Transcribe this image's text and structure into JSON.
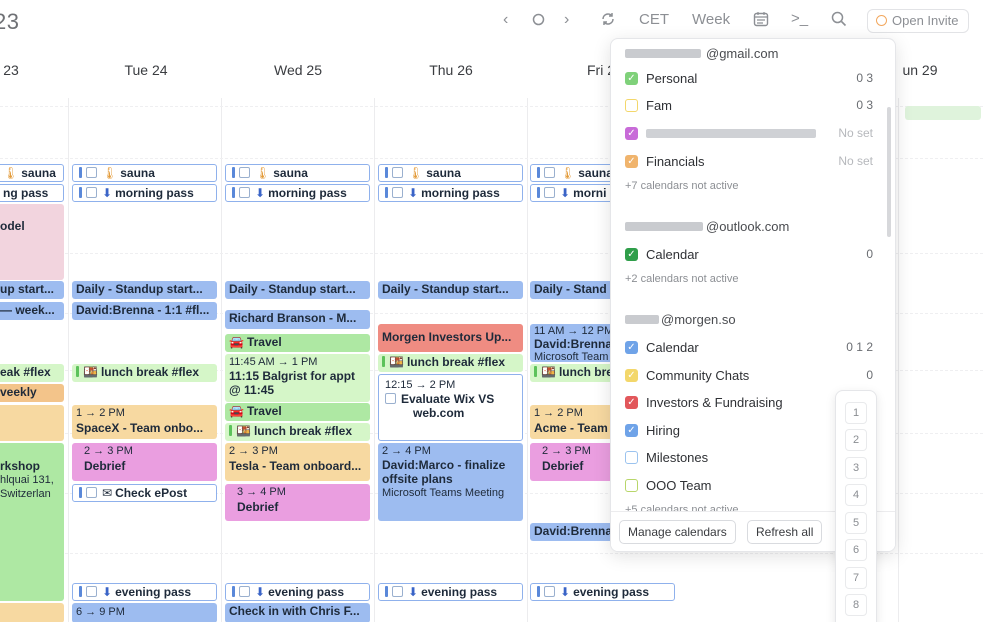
{
  "toolbar": {
    "year_fragment": "23",
    "tz_label": "CET",
    "view_label": "Week",
    "open_invite_label": "Open Invite"
  },
  "days": [
    "23",
    "Tue 24",
    "Wed 25",
    "Thu 26",
    "Fri 2",
    "un 29"
  ],
  "events": {
    "c0": [
      {
        "text": "sauna",
        "icon": "sauna"
      },
      {
        "text": "ng pass"
      },
      {
        "text": "odel"
      },
      {
        "text": "up start..."
      },
      {
        "text": "— week..."
      },
      {
        "text": "eak #flex"
      },
      {
        "text": "veekly"
      },
      {
        "text": "rkshop"
      },
      {
        "text": "hlquai 131,"
      },
      {
        "text": "Switzerlan"
      }
    ],
    "c1": [
      {
        "text": "sauna"
      },
      {
        "text": "morning pass"
      },
      {
        "text": "Daily - Standup start..."
      },
      {
        "text": "David:Brenna - 1:1 #fl..."
      },
      {
        "text": "lunch break #flex"
      },
      {
        "time": "1 → 2 PM",
        "text": "SpaceX - Team onbo..."
      },
      {
        "time": "2 → 3 PM",
        "text": "Debrief"
      },
      {
        "text": "Check ePost"
      },
      {
        "text": "evening pass"
      },
      {
        "time": "6 → 9 PM"
      }
    ],
    "c2": [
      {
        "text": "sauna"
      },
      {
        "text": "morning pass"
      },
      {
        "text": "Daily - Standup start..."
      },
      {
        "text": "Richard Branson - M..."
      },
      {
        "text": "Travel"
      },
      {
        "time": "11:45 AM → 1 PM",
        "text": "11:15 Balgrist for appt",
        "text2": "@ 11:45"
      },
      {
        "text": "Travel"
      },
      {
        "text": "lunch break #flex"
      },
      {
        "time": "2 → 3 PM",
        "text": "Tesla - Team onboard..."
      },
      {
        "time": "3 → 4 PM",
        "text": "Debrief"
      },
      {
        "text": "evening pass"
      },
      {
        "text": "Check in with Chris F..."
      }
    ],
    "c3": [
      {
        "text": "sauna"
      },
      {
        "text": "morning pass"
      },
      {
        "text": "Daily - Standup start..."
      },
      {
        "text": "Morgen Investors Up..."
      },
      {
        "text": "lunch break #flex"
      },
      {
        "time": "12:15 → 2 PM",
        "text": "Evaluate Wix VS",
        "text2": "web.com"
      },
      {
        "time": "2 → 4 PM",
        "text": "David:Marco - finalize",
        "text2": "offsite plans",
        "text3": "Microsoft Teams Meeting"
      },
      {
        "text": "evening pass"
      }
    ],
    "c4": [
      {
        "text": "sauna"
      },
      {
        "text": "morni"
      },
      {
        "text": "Daily - Stand"
      },
      {
        "time": "11 AM → 12 PM",
        "text": "David:Brenna",
        "text2": "Microsoft Team"
      },
      {
        "text": "lunch bre"
      },
      {
        "time": "1 → 2 PM",
        "text": "Acme - Team"
      },
      {
        "time": "2 → 3 PM",
        "text": "Debrief"
      },
      {
        "text": "David:Brenna"
      },
      {
        "text": "evening pass"
      }
    ]
  },
  "popover": {
    "accounts": [
      {
        "email": "@gmail.com",
        "calendars": [
          {
            "name": "Personal",
            "count": "0 3",
            "checked": true,
            "color": "#7fd17a"
          },
          {
            "name": "Fam",
            "count": "0 3",
            "checked": false,
            "color": "#f3d76b"
          },
          {
            "name": "",
            "count": "No set",
            "checked": true,
            "color": "#c86bd8"
          },
          {
            "name": "Financials",
            "count": "No set",
            "checked": true,
            "color": "#f0b46d"
          }
        ],
        "inactive": "+7 calendars not active"
      },
      {
        "email": "@outlook.com",
        "calendars": [
          {
            "name": "Calendar",
            "count": "0",
            "checked": true,
            "color": "#2f9e4a"
          }
        ],
        "inactive": "+2 calendars not active"
      },
      {
        "email": "@morgen.so",
        "calendars": [
          {
            "name": "Calendar",
            "count": "0 1 2",
            "checked": true,
            "color": "#6fa3e8"
          },
          {
            "name": "Community Chats",
            "count": "0",
            "checked": true,
            "color": "#f3d76b"
          },
          {
            "name": "Investors & Fundraising",
            "count": "",
            "checked": true,
            "color": "#e2575b"
          },
          {
            "name": "Hiring",
            "count": "",
            "checked": true,
            "color": "#6fa3e8"
          },
          {
            "name": "Milestones",
            "count": "",
            "checked": false,
            "color": "#9bc3ef"
          },
          {
            "name": "OOO Team",
            "count": "",
            "checked": false,
            "color": "#b8d66a"
          }
        ],
        "inactive": "+5 calendars not active"
      }
    ],
    "manage_label": "Manage calendars",
    "refresh_label": "Refresh all"
  },
  "number_picker": [
    "1",
    "2",
    "3",
    "4",
    "5",
    "6",
    "7",
    "8"
  ]
}
